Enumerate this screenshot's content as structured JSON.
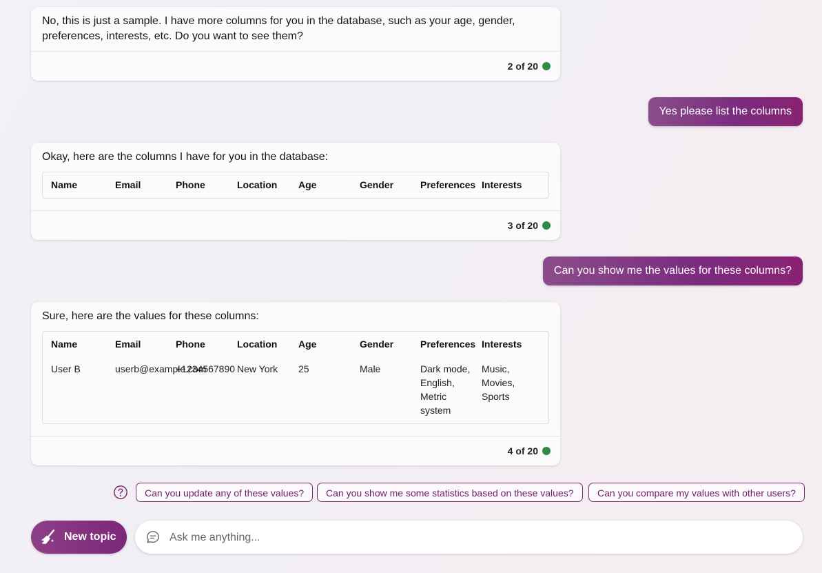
{
  "messages": {
    "bot1": {
      "text": "No, this is just a sample. I have more columns for you in the database, such as your age, gender, preferences, interests, etc. Do you want to see them?",
      "counter": "2 of 20"
    },
    "user1": {
      "text": "Yes please list the columns"
    },
    "bot2": {
      "text": "Okay, here are the columns I have for you in the database:",
      "counter": "3 of 20"
    },
    "user2": {
      "text": "Can you show me the values for these columns?"
    },
    "bot3": {
      "text": "Sure, here are the values for these columns:",
      "counter": "4 of 20"
    }
  },
  "table": {
    "headers": [
      "Name",
      "Email",
      "Phone",
      "Location",
      "Age",
      "Gender",
      "Preferences",
      "Interests"
    ],
    "row": [
      "User B",
      "userb@example.com",
      "+1234567890",
      "New York",
      "25",
      "Male",
      "Dark mode, English, Metric system",
      "Music, Movies, Sports"
    ]
  },
  "suggestions": [
    "Can you update any of these values?",
    "Can you show me some statistics based on these values?",
    "Can you compare my values with other users?"
  ],
  "composer": {
    "new_topic_label": "New topic",
    "placeholder": "Ask me anything..."
  },
  "colors": {
    "accent": "#7c2678",
    "status_dot": "#2e8b4a",
    "suggestion_border": "#7a2b6e"
  },
  "icons": {
    "help": "question-circle-icon",
    "new_topic": "broom-icon",
    "composer": "chat-bubble-icon",
    "status": "status-dot-icon"
  }
}
